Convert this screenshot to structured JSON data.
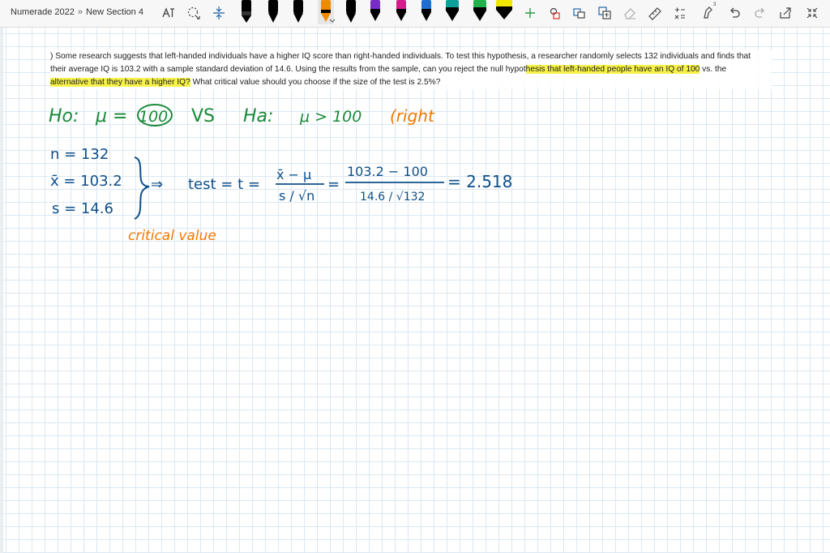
{
  "breadcrumb": {
    "notebook": "Numerade 2022",
    "separator": "»",
    "section": "New Section 4"
  },
  "toolbar": {
    "left_tools": [
      "text-mode-icon",
      "lasso-select-icon",
      "insert-space-icon"
    ],
    "pens": [
      {
        "name": "pen-black-1",
        "color": "#000000"
      },
      {
        "name": "pen-black-2",
        "color": "#000000"
      },
      {
        "name": "pen-black-3",
        "color": "#000000"
      },
      {
        "name": "pen-orange-selected",
        "color": "#f08a00",
        "selected": true
      },
      {
        "name": "pen-black-4",
        "color": "#000000"
      },
      {
        "name": "pen-purple",
        "color": "#7a2cc8"
      },
      {
        "name": "pen-magenta",
        "color": "#d81b8c"
      },
      {
        "name": "pen-blue",
        "color": "#1e6fd0"
      },
      {
        "name": "pen-teal",
        "color": "#0ca09a"
      },
      {
        "name": "pen-green",
        "color": "#21b24b"
      },
      {
        "name": "highlighter-yellow",
        "color": "#f1e600"
      },
      {
        "name": "highlighter-green",
        "color": "#4ee04e"
      },
      {
        "name": "highlighter-magenta",
        "color": "#e82bd6"
      }
    ],
    "right_tools": [
      "add-pen-icon",
      "ink-to-shape-icon",
      "ink-to-text-icon",
      "ink-to-math-icon",
      "eraser-icon",
      "ruler-icon",
      "math-icon",
      "ink-replay-icon",
      "undo-icon",
      "redo-icon",
      "full-page-view-icon",
      "collapse-icon"
    ],
    "badge_count": "3"
  },
  "problem": {
    "line1": ") Some research suggests that left-handed individuals have a higher IQ score than right-handed individuals. To test this hypothesis, a researcher randomly selects 132 individuals and finds that",
    "line2_a": "their average IQ is 103.2 with a sample standard deviation of 14.6. Using the results from the sample, can you reject the null hypot",
    "line2_hl": "hesis that left-handed people have an IQ of 100",
    "line2_b": " vs. the",
    "line3_a": "al",
    "line3_hl": "ternative that they have a higher IQ?",
    "line3_b": " What critical value should you choose if the size of the test is 2.5%?"
  },
  "handwriting": {
    "h0": "Ho:",
    "mu_eq": "μ =",
    "h0_value": "100",
    "vs": "VS",
    "ha": "Ha:",
    "ha_expr": "μ > 100",
    "right": "(right",
    "n_line": "n = 132",
    "xbar_line": "x̄ = 103.2",
    "s_line": "s = 14.6",
    "arrow": "⇒",
    "test_label": "test = t =",
    "frac1_num": "x̄ − μ",
    "frac1_den": "s / √n",
    "eq_sign": "=",
    "frac2_num": "103.2 − 100",
    "frac2_den": "14.6 / √132",
    "result": "= 2.518",
    "critical": "critical value"
  },
  "colors": {
    "ink_green": "#1a8a3a",
    "ink_blue": "#0e4f8a",
    "ink_orange": "#f07800",
    "highlight": "#f6f24a"
  }
}
